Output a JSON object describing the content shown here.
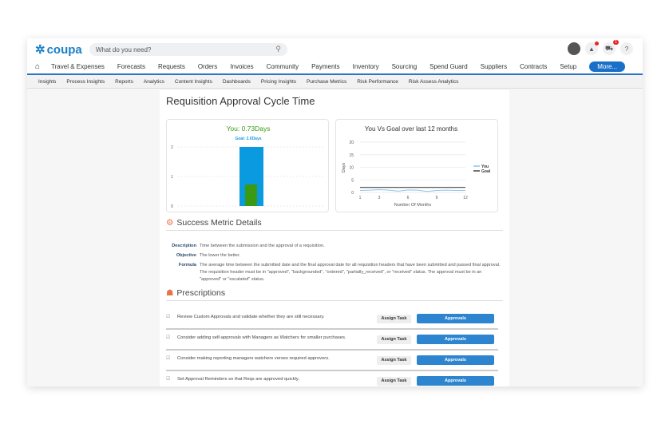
{
  "header": {
    "logo": "coupa",
    "search_placeholder": "What do you need?",
    "cart_count": "1",
    "help": "?"
  },
  "nav": {
    "items": [
      "Travel & Expenses",
      "Forecasts",
      "Requests",
      "Orders",
      "Invoices",
      "Community",
      "Payments",
      "Inventory",
      "Sourcing",
      "Spend Guard",
      "Suppliers",
      "Contracts",
      "Setup"
    ],
    "more": "More..."
  },
  "subnav": [
    "Insights",
    "Process Insights",
    "Reports",
    "Analytics",
    "Content Insights",
    "Dashboards",
    "Pricing Insights",
    "Purchase Metrics",
    "Risk Performance",
    "Risk Assess Analytics"
  ],
  "page": {
    "title": "Requisition Approval Cycle Time"
  },
  "chart_data": [
    {
      "type": "bar",
      "title": "You: 0.73Days",
      "subtitle": "Goal: 2.0Days",
      "series": [
        {
          "name": "Goal",
          "values": [
            2.0
          ],
          "color": "#0a9ae0"
        },
        {
          "name": "You",
          "values": [
            0.73
          ],
          "color": "#3a9a14"
        }
      ],
      "yticks": [
        "0",
        "1",
        "2"
      ],
      "ylim": [
        0,
        2
      ]
    },
    {
      "type": "line",
      "title": "You Vs Goal over last 12 months",
      "xlabel": "Number Of Months",
      "ylabel": "Days",
      "xticks": [
        "1",
        "3",
        "6",
        "9",
        "12"
      ],
      "yticks": [
        "0",
        "5",
        "10",
        "15",
        "20"
      ],
      "ylim": [
        0,
        20
      ],
      "xlim": [
        1,
        12
      ],
      "legend": "right",
      "series": [
        {
          "name": "You",
          "values": [
            0.8,
            0.9,
            1.1,
            0.9,
            0.5,
            1.0,
            0.9,
            0.4,
            0.8,
            0.9,
            0.8,
            0.8
          ],
          "color": "#8ec3ea"
        },
        {
          "name": "Goal",
          "values": [
            2,
            2,
            2,
            2,
            2,
            2,
            2,
            2,
            2,
            2,
            2,
            2
          ],
          "color": "#444444"
        }
      ]
    }
  ],
  "details": {
    "heading": "Success Metric Details",
    "rows": [
      {
        "k": "Description",
        "v": "Time between the submission and the approval of a requisition."
      },
      {
        "k": "Objective",
        "v": "The lower the better."
      },
      {
        "k": "Formula",
        "v": "The average time between the submitted date and the final approval date for all requisition headers that have been submitted and passed final approval. The requisition header must be in \"approved\", \"backgrounded\", \"ordered\", \"partially_received\", or \"received\" status. The approval must be in an \"approved\" or \"escalated\" status."
      }
    ]
  },
  "prescriptions": {
    "heading": "Prescriptions",
    "assign": "Assign Task",
    "items": [
      {
        "text": "Review Custom Approvals and validate whether they are still necessary.",
        "button": "Approvals"
      },
      {
        "text": "Consider adding self-approvals with Managers as Watchers for smaller purchases.",
        "button": "Approvals"
      },
      {
        "text": "Consider making reporting managers watchers verses required approvers.",
        "button": "Approvals"
      },
      {
        "text": "Set Approval Reminders so that Reqs are approved quickly.",
        "button": "Approvals"
      }
    ]
  }
}
